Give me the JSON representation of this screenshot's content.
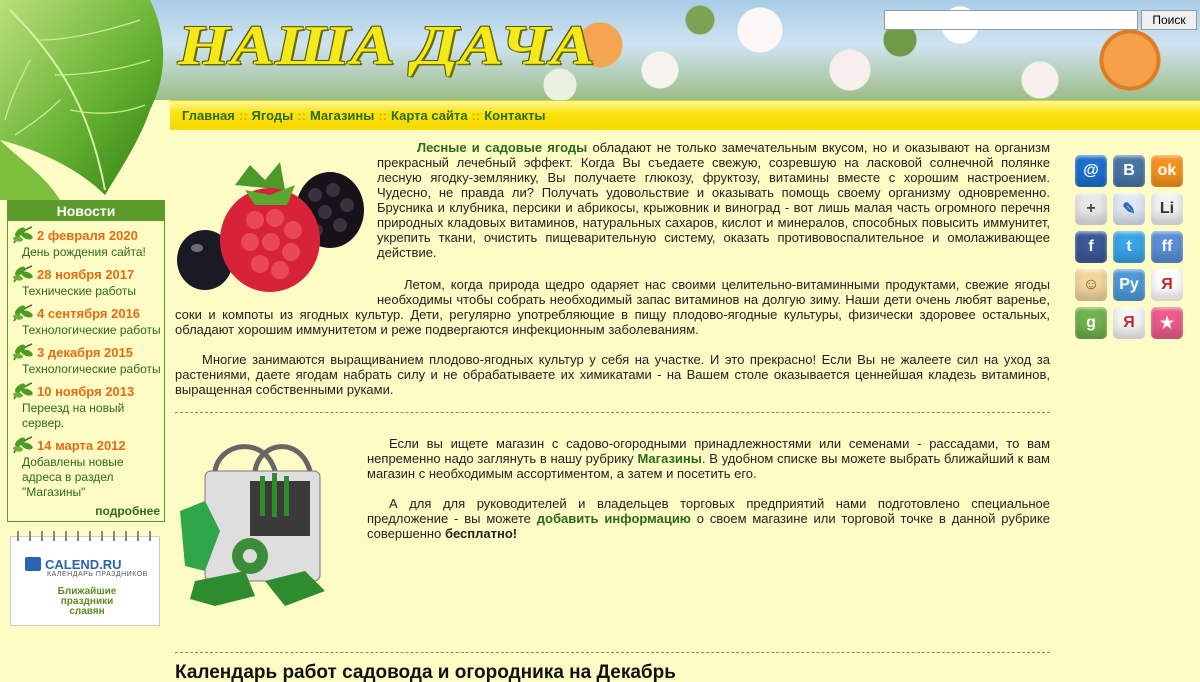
{
  "header": {
    "logo": "НАША ДАЧА",
    "search_placeholder": "",
    "search_button": "Поиск"
  },
  "nav": {
    "items": [
      "Главная",
      "Ягоды",
      "Магазины",
      "Карта сайта",
      "Контакты"
    ],
    "separator": "::"
  },
  "news": {
    "title": "Новости",
    "items": [
      {
        "date": "2 февраля 2020",
        "text": "День рождения сайта!"
      },
      {
        "date": "28 ноября 2017",
        "text": "Технические работы"
      },
      {
        "date": "4 сентября 2016",
        "text": "Технологические работы"
      },
      {
        "date": "3 декабря 2015",
        "text": "Технологические работы"
      },
      {
        "date": "10 ноября 2013",
        "text": "Переезд на новый сервер."
      },
      {
        "date": "14 марта 2012",
        "text": "Добавлены новые адреса в раздел \"Магазины\""
      }
    ],
    "more": "подробнее"
  },
  "calend": {
    "brand": "CALEND.RU",
    "subtitle": "КАЛЕНДАРЬ ПРАЗДНИКОВ",
    "near": "Ближайшие праздники славян"
  },
  "article": {
    "p1_link": "Лесные и садовые ягоды",
    "p1_text": " обладают не только замечательным вкусом, но и оказывают на организм прекрасный лечебный эффект. Когда Вы съедаете свежую, созревшую на ласковой солнечной полянке лесную ягодку-землянику, Вы получаете глюкозу, фруктозу, витамины вместе с хорошим настроением. Чудесно, не правда ли? Получать удовольствие и оказывать помощь своему организму одновременно. Брусника и клубника, персики и абрикосы, крыжовник и виноград - вот лишь малая часть огромного перечня природных кладовых витаминов, натуральных сахаров, кислот и минералов, способных повысить иммунитет, укрепить ткани, очистить пищеварительную систему, оказать противовоспалительное и омолаживающее действие.",
    "p2": "Летом, когда природа щедро одаряет нас своими целительно-витаминными продуктами, свежие ягоды необходимы чтобы собрать необходимый запас витаминов на долгую зиму. Наши дети очень любят варенье, соки и компоты из ягодных культур. Дети, регулярно употребляющие в пищу плодово-ягодные культуры, физически здоровее остальных, обладают хорошим иммунитетом и реже подвергаются инфекционным заболеваниям.",
    "p3": "Многие занимаются выращиванием плодово-ягодных культур у себя на участке. И это прекрасно! Если Вы не жалеете сил на уход за растениями, даете ягодам набрать силу и не обрабатываете их химикатами - на Вашем столе оказывается ценнейшая кладезь витаминов, выращенная собственными руками.",
    "p4_a": "Если вы ищете магазин с садово-огородными принадлежностями или семенами - рассадами, то вам непременно надо заглянуть в нашу рубрику ",
    "p4_link": "Магазины",
    "p4_b": ". В удобном списке вы можете выбрать ближайший к вам магазин с необходимым ассортиментом, а затем и посетить его.",
    "p5_a": "А для для руководителей и владельцев торговых предприятий нами подготовлено специальное предложение - вы можете ",
    "p5_link": "добавить информацию",
    "p5_b": " о своем магазине или торговой точке в данной рубрике совершенно ",
    "p5_bold": "бесплатно!",
    "calendar_title": "Календарь работ садовода и огородника на Декабрь"
  },
  "social": [
    {
      "icon": "mail-ru-icon",
      "glyph": "@",
      "color": "#1e6fd0"
    },
    {
      "icon": "vkontakte-icon",
      "glyph": "B",
      "color": "#4a76a8"
    },
    {
      "icon": "odnoklassniki-icon",
      "glyph": "ok",
      "color": "#f7931e"
    },
    {
      "icon": "google-plus-icon",
      "glyph": "+",
      "color": "#e8e8e8"
    },
    {
      "icon": "livejournal-icon",
      "glyph": "✎",
      "color": "#dfe9f5"
    },
    {
      "icon": "liveinternet-icon",
      "glyph": "Li",
      "color": "#f2f2f2"
    },
    {
      "icon": "facebook-icon",
      "glyph": "f",
      "color": "#3b5998"
    },
    {
      "icon": "twitter-icon",
      "glyph": "t",
      "color": "#3aa4e8"
    },
    {
      "icon": "friendfeed-icon",
      "glyph": "ff",
      "color": "#5a8fd8"
    },
    {
      "icon": "moi-krug-icon",
      "glyph": "☺",
      "color": "#f4d7a0"
    },
    {
      "icon": "ya-ru-icon",
      "glyph": "Pу",
      "color": "#4e9ad8"
    },
    {
      "icon": "yandex-people-icon",
      "glyph": "Я",
      "color": "#fff"
    },
    {
      "icon": "google-bookmarks-icon",
      "glyph": "g",
      "color": "#6fb24a"
    },
    {
      "icon": "yandex-bookmarks-icon",
      "glyph": "Я",
      "color": "#f5f5f5"
    },
    {
      "icon": "favorites-star-icon",
      "glyph": "★",
      "color": "#ee5c8c"
    }
  ]
}
